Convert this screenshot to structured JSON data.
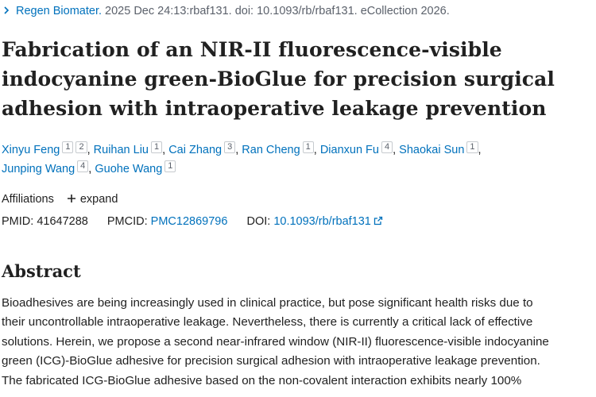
{
  "citation": {
    "journal": "Regen Biomater.",
    "details": "2025 Dec 24:13:rbaf131. doi: 10.1093/rb/rbaf131. eCollection 2026."
  },
  "title_lines": [
    "Fabrication of an NIR-II fluorescence-visible",
    "indocyanine green-BioGlue for precision surgical",
    "adhesion with intraoperative leakage prevention"
  ],
  "authors": [
    {
      "name": "Xinyu Feng",
      "affs": [
        "1",
        "2"
      ]
    },
    {
      "name": "Ruihan Liu",
      "affs": [
        "1"
      ]
    },
    {
      "name": "Cai Zhang",
      "affs": [
        "3"
      ]
    },
    {
      "name": "Ran Cheng",
      "affs": [
        "1"
      ]
    },
    {
      "name": "Dianxun Fu",
      "affs": [
        "4"
      ]
    },
    {
      "name": "Shaokai Sun",
      "affs": [
        "1"
      ]
    },
    {
      "name": "Junping Wang",
      "affs": [
        "4"
      ]
    },
    {
      "name": "Guohe Wang",
      "affs": [
        "1"
      ]
    }
  ],
  "affiliations": {
    "label": "Affiliations",
    "expand_label": "expand"
  },
  "ids": {
    "pmid_label": "PMID:",
    "pmid": "41647288",
    "pmcid_label": "PMCID:",
    "pmcid": "PMC12869796",
    "doi_label": "DOI:",
    "doi": "10.1093/rb/rbaf131"
  },
  "abstract": {
    "heading": "Abstract",
    "lines": [
      "Bioadhesives are being increasingly used in clinical practice, but pose significant health risks due to",
      "their uncontrollable intraoperative leakage. Nevertheless, there is currently a critical lack of effective",
      "solutions. Herein, we propose a second near-infrared window (NIR-II) fluorescence-visible indocyanine",
      "green (ICG)-BioGlue adhesive for precision surgical adhesion with intraoperative leakage prevention.",
      "The fabricated ICG-BioGlue adhesive based on the non-covalent interaction exhibits nearly 100%"
    ]
  },
  "colors": {
    "link": "#0071bc",
    "text": "#212121",
    "muted": "#5b616b"
  },
  "icons": [
    "chevron-right-icon",
    "plus-icon",
    "external-link-icon"
  ]
}
